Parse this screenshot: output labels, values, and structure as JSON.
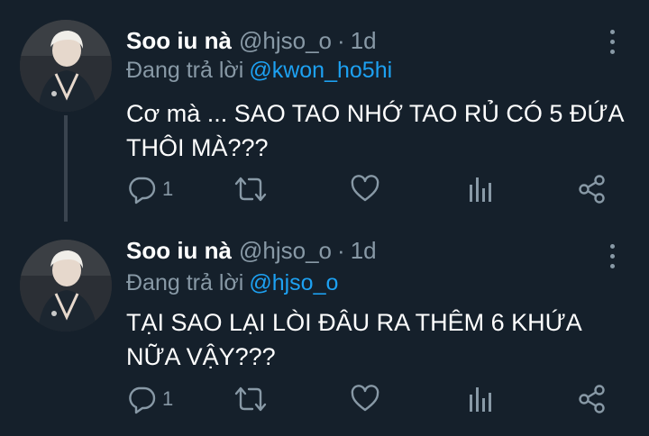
{
  "tweets": [
    {
      "name": "Soo iu nà",
      "handle": "@hjso_o",
      "separator": "·",
      "time": "1d",
      "reply_prefix": "Đang trả lời",
      "reply_to": "@kwon_ho5hi",
      "text": "Cơ mà ... SAO TAO NHỚ TAO RỦ CÓ 5 ĐỨA THÔI MÀ???",
      "reply_count": "1"
    },
    {
      "name": "Soo iu nà",
      "handle": "@hjso_o",
      "separator": "·",
      "time": "1d",
      "reply_prefix": "Đang trả lời",
      "reply_to": "@hjso_o",
      "text": "TẠI SAO LẠI LÒI ĐÂU RA THÊM 6 KHỨA NỮA VẬY???",
      "reply_count": "1"
    }
  ],
  "icons": {
    "more": "more-vertical-icon",
    "reply": "reply-icon",
    "retweet": "retweet-icon",
    "like": "heart-icon",
    "analytics": "analytics-icon",
    "share": "share-icon"
  },
  "colors": {
    "background": "#15202b",
    "text": "#ffffff",
    "secondary": "#8899a6",
    "link": "#1da1f2",
    "thread_line": "#3a444f"
  }
}
